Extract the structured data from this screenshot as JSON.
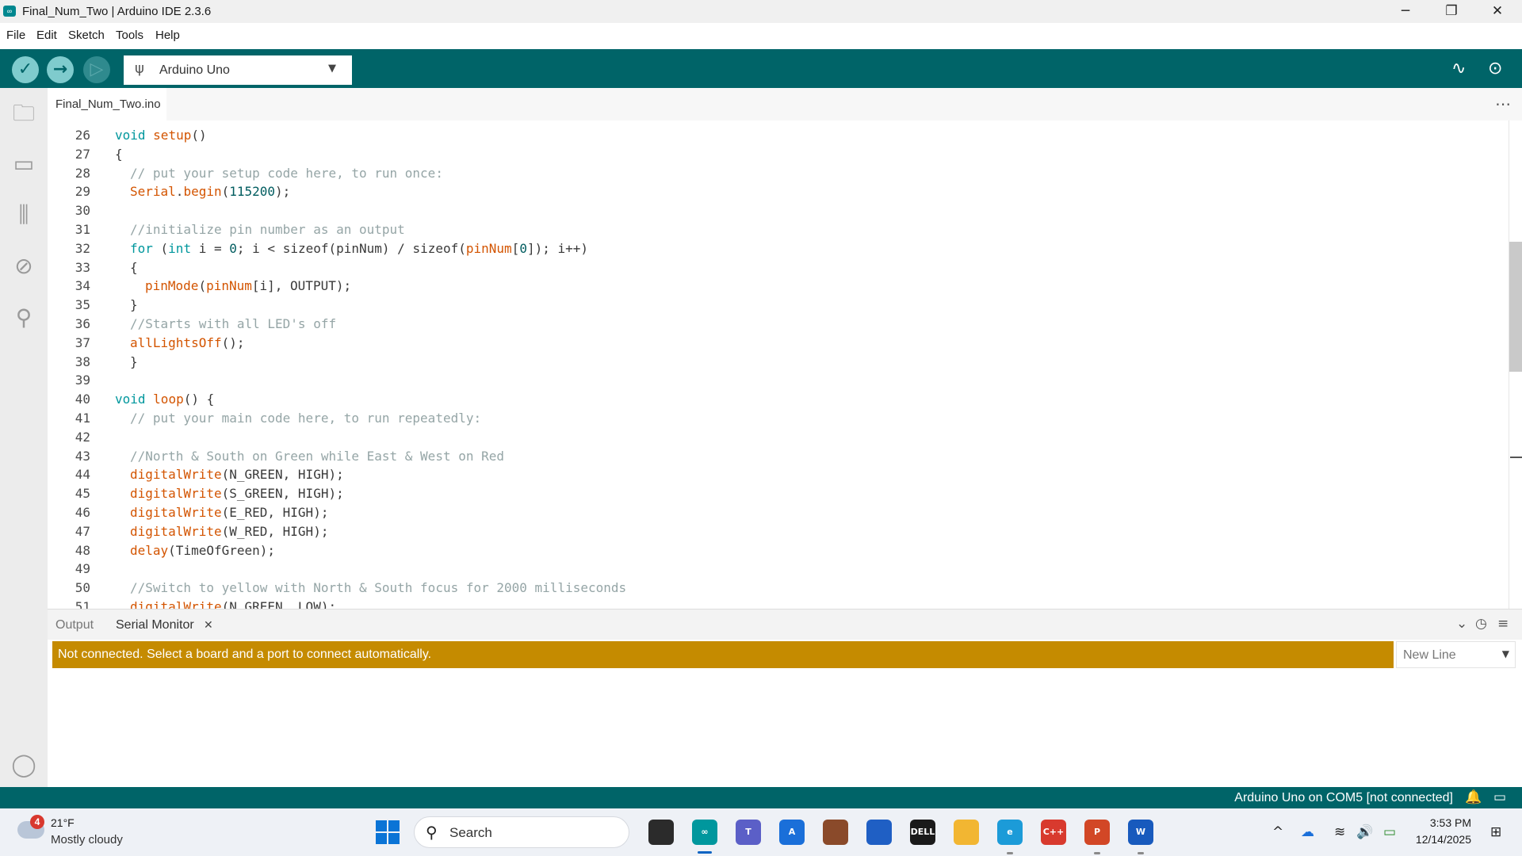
{
  "window": {
    "title": "Final_Num_Two | Arduino IDE 2.3.6",
    "app_icon_glyph": "∞",
    "minimize_glyph": "─",
    "maximize_glyph": "❐",
    "close_glyph": "✕"
  },
  "menu": [
    "File",
    "Edit",
    "Sketch",
    "Tools",
    "Help"
  ],
  "toolbar": {
    "verify_glyph": "✓",
    "upload_glyph": "→",
    "debug_glyph": "▷",
    "board": "Arduino Uno",
    "usb_glyph": "ψ",
    "caret_glyph": "▼",
    "plotter_glyph": "∿",
    "serial_monitor_glyph": "⊙"
  },
  "sidebar_icons": [
    "folder-icon",
    "board-manager-icon",
    "library-manager-icon",
    "debug-icon",
    "search-icon",
    "account-icon"
  ],
  "sidebar_glyphs": {
    "folder": "🗀",
    "board": "▭",
    "library": "⫼",
    "debug": "⊘",
    "search": "⚲",
    "account": "◯"
  },
  "editor": {
    "tab": "Final_Num_Two.ino",
    "more_glyph": "⋯",
    "lines": [
      {
        "n": "26",
        "indent": 0,
        "parts": [
          [
            "kw",
            "void "
          ],
          [
            "fn",
            "setup"
          ],
          [
            "",
            "()"
          ]
        ]
      },
      {
        "n": "27",
        "indent": 0,
        "parts": [
          [
            "",
            "{"
          ]
        ]
      },
      {
        "n": "28",
        "indent": 1,
        "parts": [
          [
            "cm",
            "// put your setup code here, to run once:"
          ]
        ]
      },
      {
        "n": "29",
        "indent": 1,
        "parts": [
          [
            "fn",
            "Serial"
          ],
          [
            "",
            "."
          ],
          [
            "fn",
            "begin"
          ],
          [
            "",
            "("
          ],
          [
            "nm",
            "115200"
          ],
          [
            "",
            ");"
          ]
        ]
      },
      {
        "n": "30",
        "indent": 0,
        "parts": []
      },
      {
        "n": "31",
        "indent": 1,
        "parts": [
          [
            "cm",
            "//initialize pin number as an output"
          ]
        ]
      },
      {
        "n": "32",
        "indent": 1,
        "parts": [
          [
            "kw",
            "for "
          ],
          [
            "",
            "("
          ],
          [
            "kw",
            "int"
          ],
          [
            "",
            " i = "
          ],
          [
            "nm",
            "0"
          ],
          [
            "",
            "; i < sizeof(pinNum) / sizeof("
          ],
          [
            "fn",
            "pinNum"
          ],
          [
            "",
            "["
          ],
          [
            "nm",
            "0"
          ],
          [
            "",
            "]); i++)"
          ]
        ]
      },
      {
        "n": "33",
        "indent": 1,
        "parts": [
          [
            "",
            "{"
          ]
        ]
      },
      {
        "n": "34",
        "indent": 2,
        "parts": [
          [
            "fn",
            "pinMode"
          ],
          [
            "",
            "("
          ],
          [
            "fn",
            "pinNum"
          ],
          [
            "",
            "[i], OUTPUT);"
          ]
        ]
      },
      {
        "n": "35",
        "indent": 1,
        "parts": [
          [
            "",
            "}"
          ]
        ]
      },
      {
        "n": "36",
        "indent": 1,
        "parts": [
          [
            "cm",
            "//Starts with all LED's off"
          ]
        ]
      },
      {
        "n": "37",
        "indent": 1,
        "parts": [
          [
            "fn",
            "allLightsOff"
          ],
          [
            "",
            "();"
          ]
        ]
      },
      {
        "n": "38",
        "indent": 1,
        "parts": [
          [
            "",
            "}"
          ]
        ]
      },
      {
        "n": "39",
        "indent": 0,
        "parts": []
      },
      {
        "n": "40",
        "indent": 0,
        "parts": [
          [
            "kw",
            "void "
          ],
          [
            "fn",
            "loop"
          ],
          [
            "",
            "() {"
          ]
        ]
      },
      {
        "n": "41",
        "indent": 1,
        "parts": [
          [
            "cm",
            "// put your main code here, to run repeatedly:"
          ]
        ]
      },
      {
        "n": "42",
        "indent": 0,
        "parts": []
      },
      {
        "n": "43",
        "indent": 1,
        "parts": [
          [
            "cm",
            "//North & South on Green while East & West on Red"
          ]
        ]
      },
      {
        "n": "44",
        "indent": 1,
        "parts": [
          [
            "fn",
            "digitalWrite"
          ],
          [
            "",
            "(N_GREEN, HIGH);"
          ]
        ]
      },
      {
        "n": "45",
        "indent": 1,
        "parts": [
          [
            "fn",
            "digitalWrite"
          ],
          [
            "",
            "(S_GREEN, HIGH);"
          ]
        ]
      },
      {
        "n": "46",
        "indent": 1,
        "parts": [
          [
            "fn",
            "digitalWrite"
          ],
          [
            "",
            "(E_RED, HIGH);"
          ]
        ]
      },
      {
        "n": "47",
        "indent": 1,
        "parts": [
          [
            "fn",
            "digitalWrite"
          ],
          [
            "",
            "(W_RED, HIGH);"
          ]
        ]
      },
      {
        "n": "48",
        "indent": 1,
        "parts": [
          [
            "fn",
            "delay"
          ],
          [
            "",
            "(TimeOfGreen);"
          ]
        ]
      },
      {
        "n": "49",
        "indent": 0,
        "parts": []
      },
      {
        "n": "50",
        "indent": 1,
        "parts": [
          [
            "cm",
            "//Switch to yellow with North & South focus for 2000 milliseconds"
          ]
        ]
      },
      {
        "n": "51",
        "indent": 1,
        "parts": [
          [
            "fn",
            "digitalWrite"
          ],
          [
            "",
            "(N_GREEN, LOW);"
          ]
        ]
      }
    ]
  },
  "panel": {
    "tab_output": "Output",
    "tab_serial": "Serial Monitor",
    "close_glyph": "✕",
    "collapse_glyph": "⌄",
    "timestamp_glyph": "◷",
    "clear_glyph": "≡",
    "notice": "Not connected. Select a board and a port to connect automatically.",
    "line_ending": "New Line",
    "line_ending_caret": "▼"
  },
  "status": {
    "text": "Arduino Uno on COM5 [not connected]",
    "bell_glyph": "🔔",
    "layout_glyph": "▭"
  },
  "taskbar": {
    "weather_badge": "4",
    "weather_temp": "21°F",
    "weather_desc": "Mostly cloudy",
    "search_label": "Search",
    "search_glyph": "⚲",
    "apps": [
      {
        "name": "taskview-app-icon",
        "label": "",
        "color": "#2b2b2b"
      },
      {
        "name": "arduino-app-icon",
        "label": "∞",
        "color": "#00979d"
      },
      {
        "name": "teams-app-icon",
        "label": "T",
        "color": "#5b5fc7"
      },
      {
        "name": "azure-app-icon",
        "label": "A",
        "color": "#1a6fd9"
      },
      {
        "name": "photos-app-icon",
        "label": "",
        "color": "#8a4a2a"
      },
      {
        "name": "store-app-icon",
        "label": "",
        "color": "#1f5fc4"
      },
      {
        "name": "dell-app-icon",
        "label": "DELL",
        "color": "#1a1a1a"
      },
      {
        "name": "file-explorer-app-icon",
        "label": "",
        "color": "#f2b632"
      },
      {
        "name": "edge-app-icon",
        "label": "e",
        "color": "#1c9bd8"
      },
      {
        "name": "devcpp-app-icon",
        "label": "C++",
        "color": "#d83a2e"
      },
      {
        "name": "powerpoint-app-icon",
        "label": "P",
        "color": "#d24726"
      },
      {
        "name": "word-app-icon",
        "label": "W",
        "color": "#185abd"
      }
    ],
    "tray_glyphs": {
      "chevron": "^",
      "onedrive": "☁",
      "wifi": "≋",
      "volume": "🔊",
      "battery": "▭",
      "notifications": "⊞"
    },
    "time": "3:53 PM",
    "date": "12/14/2025"
  }
}
